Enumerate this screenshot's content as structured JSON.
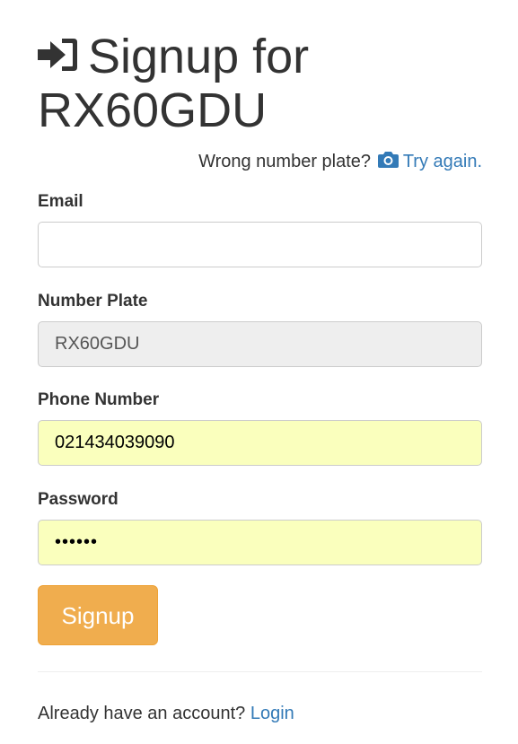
{
  "header": {
    "title": "Signup for RX60GDU",
    "icon": "login-icon"
  },
  "wrong_plate": {
    "text": "Wrong number plate?",
    "icon": "camera-icon",
    "link_label": "Try again."
  },
  "form": {
    "email": {
      "label": "Email",
      "value": ""
    },
    "number_plate": {
      "label": "Number Plate",
      "value": "RX60GDU"
    },
    "phone": {
      "label": "Phone Number",
      "value": "021434039090"
    },
    "password": {
      "label": "Password",
      "value": "••••••"
    },
    "submit_label": "Signup"
  },
  "footer": {
    "text": "Already have an account?",
    "link_label": "Login"
  },
  "colors": {
    "link": "#337ab7",
    "button": "#f0ad4e",
    "autofill": "#faffbd",
    "readonly": "#eeeeee"
  }
}
